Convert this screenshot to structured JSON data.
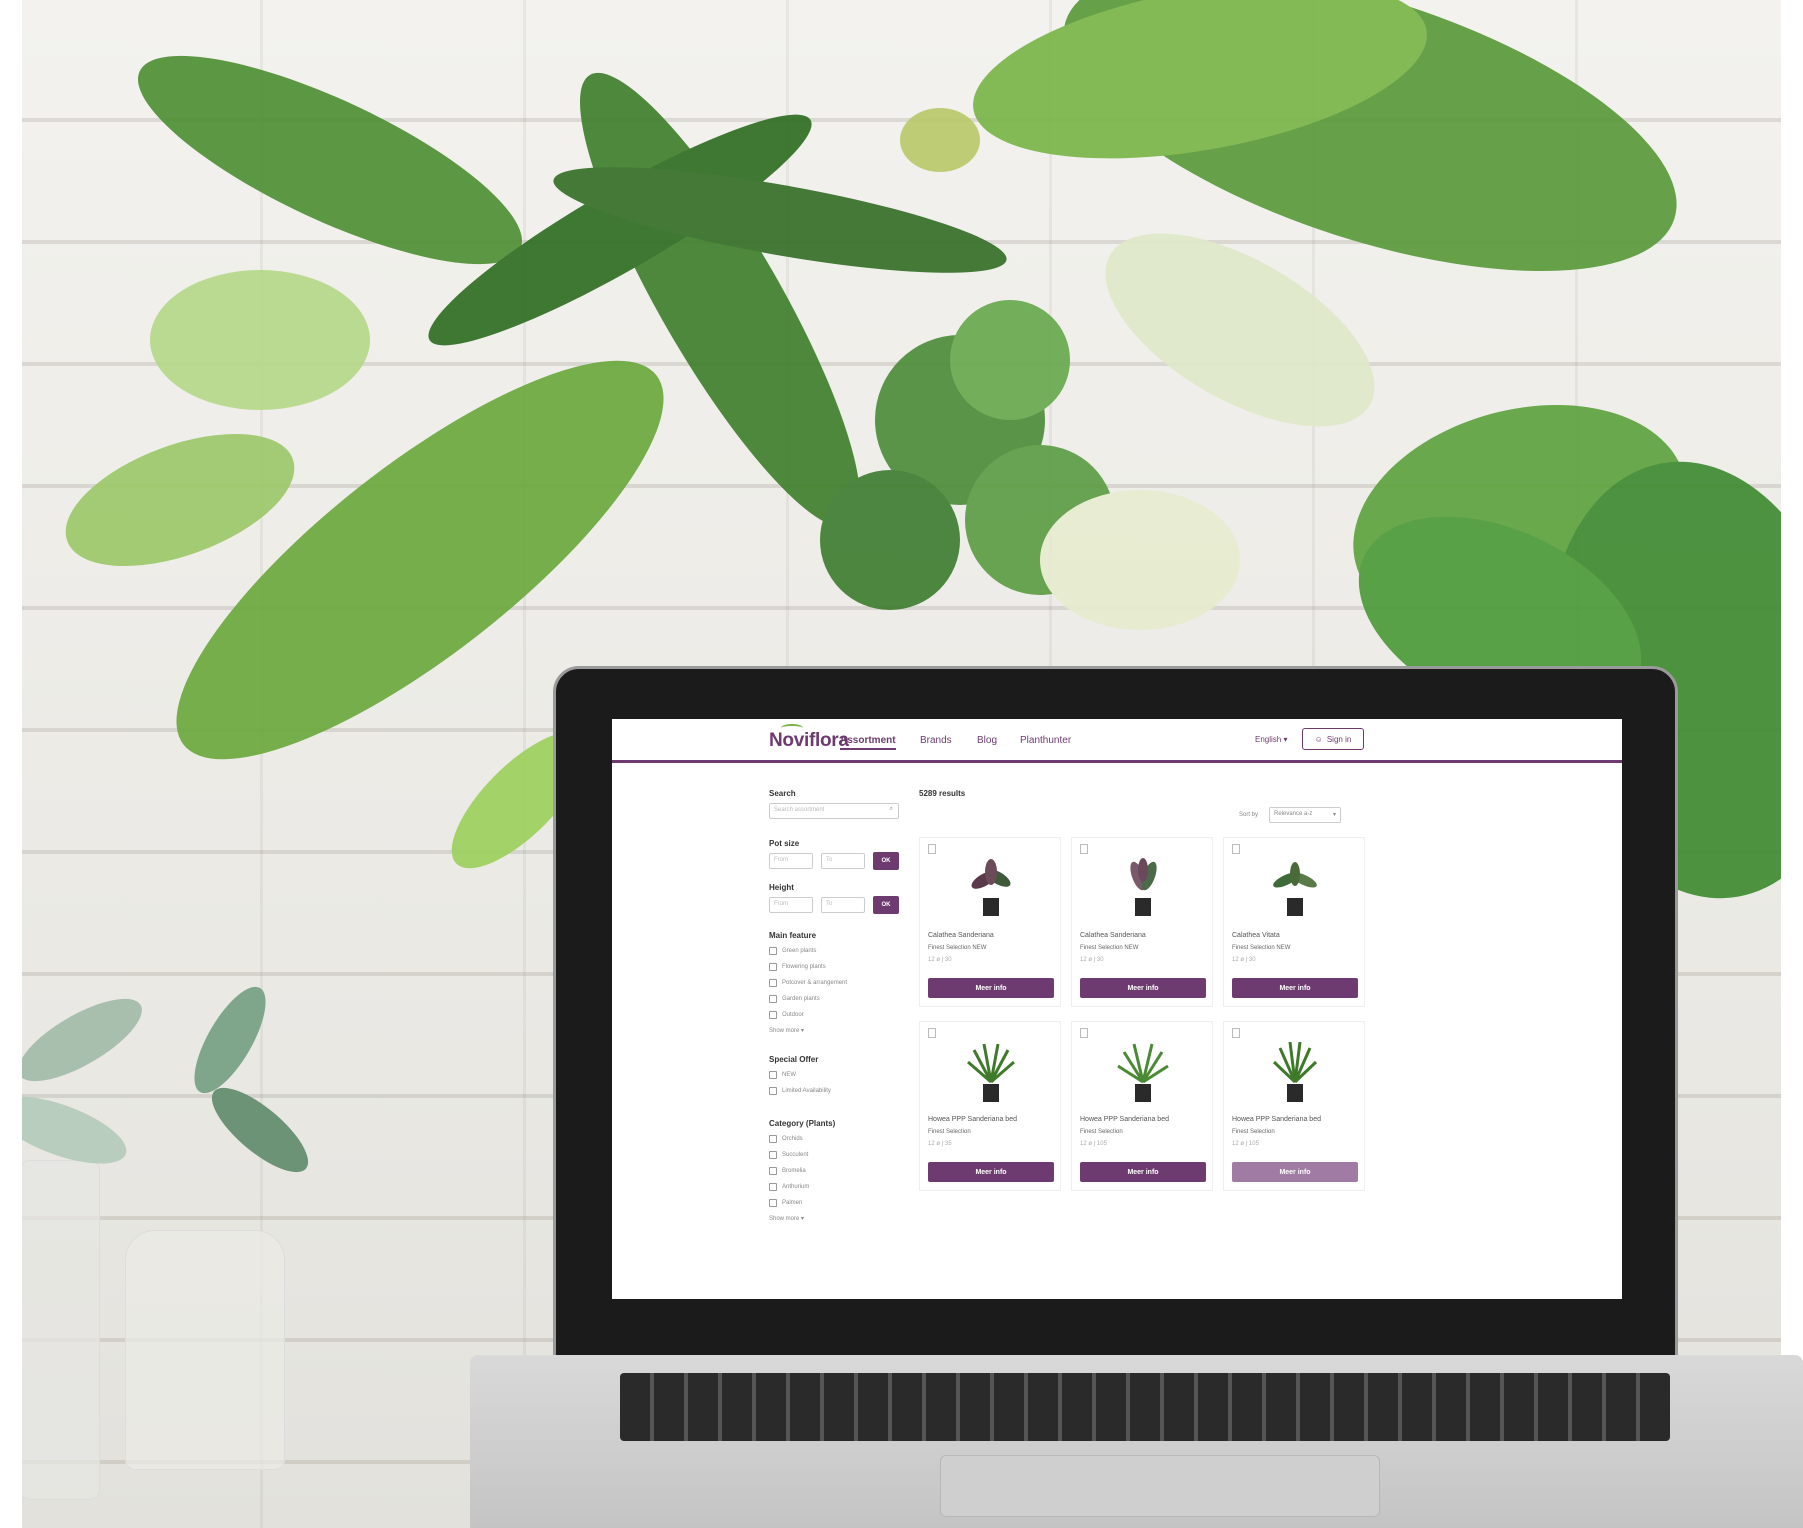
{
  "site": {
    "logo": "Noviflora",
    "nav": [
      "Assortment",
      "Brands",
      "Blog",
      "Planthunter"
    ],
    "language": "English ▾",
    "signin": "Sign in"
  },
  "sidebar": {
    "search_label": "Search",
    "search_placeholder": "Search assortment",
    "pot_size_label": "Pot size",
    "height_label": "Height",
    "min_placeholder": "From",
    "max_placeholder": "To",
    "ok": "OK",
    "main_feature_label": "Main feature",
    "main_feature_items": [
      "Green plants",
      "Flowering plants",
      "Potcover & arrangement",
      "Garden plants",
      "Outdoor"
    ],
    "show_more": "Show more ▾",
    "special_offer_label": "Special Offer",
    "special_offer_items": [
      "NEW",
      "Limited Availability"
    ],
    "category_label": "Category (Plants)",
    "category_items": [
      "Orchids",
      "Succulent",
      "Bromelia",
      "Anthurium",
      "Palmen"
    ],
    "category_more": "Show more ▾"
  },
  "main": {
    "results": "5289 results",
    "sort_label": "Sort by",
    "sort_value": "Relevance a-z"
  },
  "products": [
    {
      "name": "Calathea Sanderiana",
      "sub": "Finest Selection NEW",
      "meta": "12 ø | 30",
      "button": "Meer info"
    },
    {
      "name": "Calathea Sanderiana",
      "sub": "Finest Selection NEW",
      "meta": "12 ø | 30",
      "button": "Meer info"
    },
    {
      "name": "Calathea Vitata",
      "sub": "Finest Selection NEW",
      "meta": "12 ø | 30",
      "button": "Meer info"
    },
    {
      "name": "Howea PPP Sanderiana bed",
      "sub": "Finest Selection",
      "meta": "12 ø | 35",
      "button": "Meer info"
    },
    {
      "name": "Howea PPP Sanderiana bed",
      "sub": "Finest Selection",
      "meta": "12 ø | 105",
      "button": "Meer info"
    },
    {
      "name": "Howea PPP Sanderiana bed",
      "sub": "Finest Selection",
      "meta": "12 ø | 105",
      "button": "Meer info"
    }
  ],
  "colors": {
    "brand": "#6d3b6f",
    "accent": "#7bb24a"
  }
}
